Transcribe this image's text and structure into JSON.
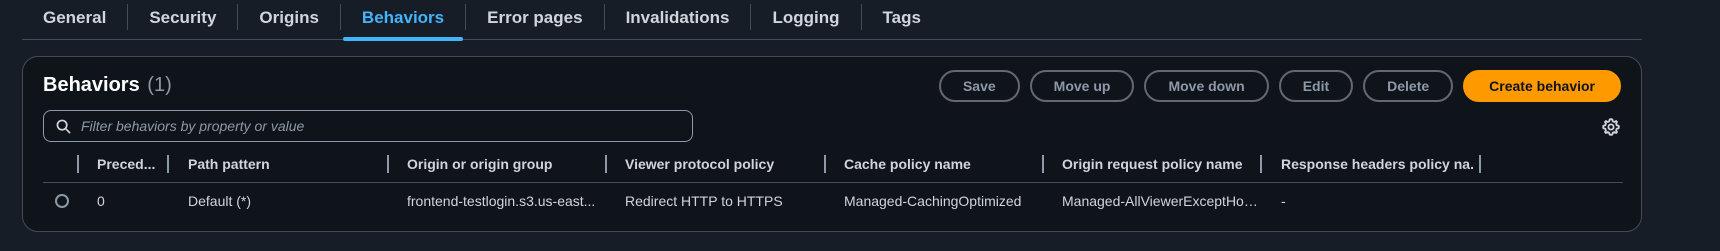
{
  "tabs": [
    {
      "label": "General"
    },
    {
      "label": "Security"
    },
    {
      "label": "Origins"
    },
    {
      "label": "Behaviors"
    },
    {
      "label": "Error pages"
    },
    {
      "label": "Invalidations"
    },
    {
      "label": "Logging"
    },
    {
      "label": "Tags"
    }
  ],
  "active_tab": "Behaviors",
  "panel": {
    "title": "Behaviors",
    "count": "(1)",
    "buttons": {
      "save": "Save",
      "move_up": "Move up",
      "move_down": "Move down",
      "edit": "Edit",
      "delete": "Delete",
      "create": "Create behavior"
    },
    "search_placeholder": "Filter behaviors by property or value"
  },
  "table": {
    "headers": [
      "Preced...",
      "Path pattern",
      "Origin or origin group",
      "Viewer protocol policy",
      "Cache policy name",
      "Origin request policy name",
      "Response headers policy na..."
    ],
    "rows": [
      {
        "precedence": "0",
        "path_pattern": "Default (*)",
        "origin": "frontend-testlogin.s3.us-east...",
        "viewer_protocol_policy": "Redirect HTTP to HTTPS",
        "cache_policy": "Managed-CachingOptimized",
        "origin_request_policy": "Managed-AllViewerExceptHostHea",
        "response_headers_policy": "-"
      }
    ]
  },
  "colors": {
    "accent": "#42b4ff",
    "primary_button": "#ff9900",
    "background": "#161d26",
    "panel": "#0f141a"
  },
  "icons": {
    "search": "search-icon",
    "settings": "gear-icon"
  }
}
